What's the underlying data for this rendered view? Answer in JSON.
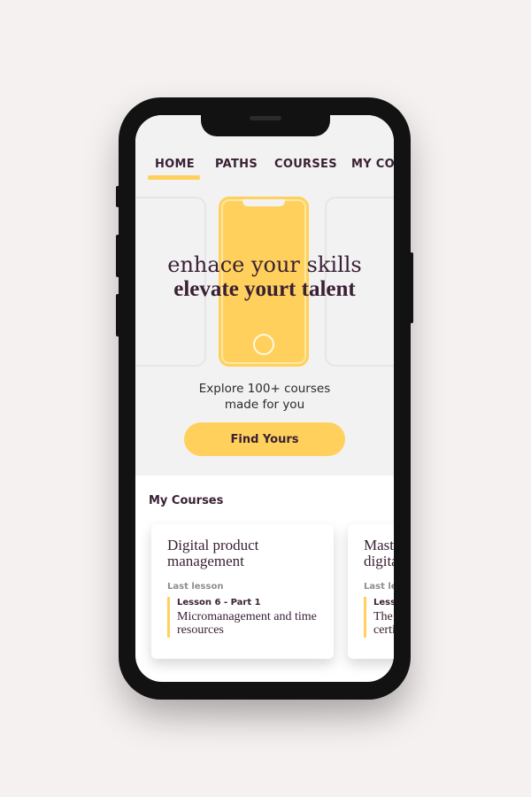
{
  "tabs": [
    "HOME",
    "PATHS",
    "COURSES",
    "MY COURSES"
  ],
  "hero": {
    "line1": "enhace your skills",
    "line2": "elevate yourt talent",
    "explore_line1": "Explore 100+ courses",
    "explore_line2": "made for you",
    "cta": "Find Yours"
  },
  "my_courses": {
    "title": "My Courses",
    "cards": [
      {
        "title": "Digital product management",
        "last_lesson_label": "Last lesson",
        "lesson_number": "Lesson 6 - Part 1",
        "lesson_name": "Micromanagement and time resources"
      },
      {
        "title": "Master digital",
        "last_lesson_label": "Last lesson",
        "lesson_number": "Lesson",
        "lesson_name": "The certi"
      }
    ]
  },
  "colors": {
    "accent": "#ffd15c",
    "brand_text": "#3a2035",
    "hero_bg": "#f2f2f2",
    "page_bg": "#f6f1f1",
    "phone_frame": "#121212"
  },
  "icons": [
    "home-button-circle-icon"
  ]
}
